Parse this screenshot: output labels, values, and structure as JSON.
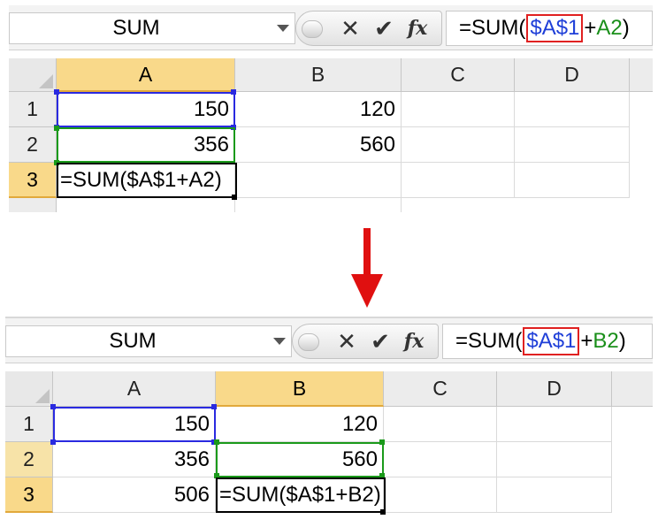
{
  "top": {
    "name_box": "SUM",
    "formula_prefix": "=SUM(",
    "formula_ref1": "$A$1",
    "formula_plus": "+",
    "formula_ref2": "A2",
    "formula_suffix": ")",
    "columns": [
      "A",
      "B",
      "C",
      "D"
    ],
    "rows": [
      "1",
      "2",
      "3"
    ],
    "cells": {
      "A1": "150",
      "B1": "120",
      "A2": "356",
      "B2": "560",
      "A3": "=SUM($A$1+A2)"
    },
    "selected_cell": "A3"
  },
  "bottom": {
    "name_box": "SUM",
    "formula_prefix": "=SUM(",
    "formula_ref1": "$A$1",
    "formula_plus": "+",
    "formula_ref2": "B2",
    "formula_suffix": ")",
    "columns": [
      "A",
      "B",
      "C",
      "D"
    ],
    "rows": [
      "1",
      "2",
      "3"
    ],
    "cells": {
      "A1": "150",
      "B1": "120",
      "A2": "356",
      "B2": "560",
      "A3": "506",
      "B3": "=SUM($A$1+B2)"
    },
    "selected_cell": "B3"
  },
  "icons": {
    "cancel": "close-icon",
    "enter": "checkmark-icon",
    "function": "insert-function-icon",
    "transition": "down-arrow-icon"
  },
  "colors": {
    "ref1_text": "#1f3fd8",
    "ref1_box": "#e02020",
    "ref2_text": "#1a8f1a",
    "selected_header": "#f9d98a",
    "arrow": "#e01010"
  }
}
